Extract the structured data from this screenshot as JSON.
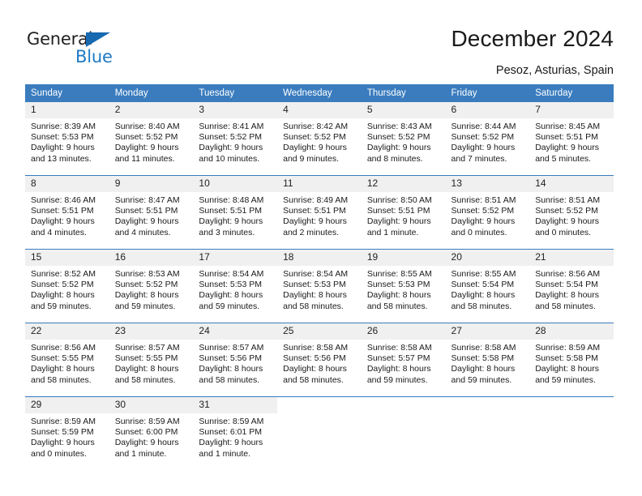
{
  "brand": {
    "name_part1": "General",
    "name_part2": "Blue",
    "accent_color": "#1f7ac4",
    "triangle_color": "#1769b0"
  },
  "header": {
    "title": "December 2024",
    "location": "Pesoz, Asturias, Spain"
  },
  "calendar": {
    "header_bg": "#3a7cbe",
    "daynum_bg": "#f0f0f0",
    "weekdays": [
      "Sunday",
      "Monday",
      "Tuesday",
      "Wednesday",
      "Thursday",
      "Friday",
      "Saturday"
    ],
    "weeks": [
      [
        {
          "day": "1",
          "sunrise": "Sunrise: 8:39 AM",
          "sunset": "Sunset: 5:53 PM",
          "daylight": "Daylight: 9 hours and 13 minutes."
        },
        {
          "day": "2",
          "sunrise": "Sunrise: 8:40 AM",
          "sunset": "Sunset: 5:52 PM",
          "daylight": "Daylight: 9 hours and 11 minutes."
        },
        {
          "day": "3",
          "sunrise": "Sunrise: 8:41 AM",
          "sunset": "Sunset: 5:52 PM",
          "daylight": "Daylight: 9 hours and 10 minutes."
        },
        {
          "day": "4",
          "sunrise": "Sunrise: 8:42 AM",
          "sunset": "Sunset: 5:52 PM",
          "daylight": "Daylight: 9 hours and 9 minutes."
        },
        {
          "day": "5",
          "sunrise": "Sunrise: 8:43 AM",
          "sunset": "Sunset: 5:52 PM",
          "daylight": "Daylight: 9 hours and 8 minutes."
        },
        {
          "day": "6",
          "sunrise": "Sunrise: 8:44 AM",
          "sunset": "Sunset: 5:52 PM",
          "daylight": "Daylight: 9 hours and 7 minutes."
        },
        {
          "day": "7",
          "sunrise": "Sunrise: 8:45 AM",
          "sunset": "Sunset: 5:51 PM",
          "daylight": "Daylight: 9 hours and 5 minutes."
        }
      ],
      [
        {
          "day": "8",
          "sunrise": "Sunrise: 8:46 AM",
          "sunset": "Sunset: 5:51 PM",
          "daylight": "Daylight: 9 hours and 4 minutes."
        },
        {
          "day": "9",
          "sunrise": "Sunrise: 8:47 AM",
          "sunset": "Sunset: 5:51 PM",
          "daylight": "Daylight: 9 hours and 4 minutes."
        },
        {
          "day": "10",
          "sunrise": "Sunrise: 8:48 AM",
          "sunset": "Sunset: 5:51 PM",
          "daylight": "Daylight: 9 hours and 3 minutes."
        },
        {
          "day": "11",
          "sunrise": "Sunrise: 8:49 AM",
          "sunset": "Sunset: 5:51 PM",
          "daylight": "Daylight: 9 hours and 2 minutes."
        },
        {
          "day": "12",
          "sunrise": "Sunrise: 8:50 AM",
          "sunset": "Sunset: 5:51 PM",
          "daylight": "Daylight: 9 hours and 1 minute."
        },
        {
          "day": "13",
          "sunrise": "Sunrise: 8:51 AM",
          "sunset": "Sunset: 5:52 PM",
          "daylight": "Daylight: 9 hours and 0 minutes."
        },
        {
          "day": "14",
          "sunrise": "Sunrise: 8:51 AM",
          "sunset": "Sunset: 5:52 PM",
          "daylight": "Daylight: 9 hours and 0 minutes."
        }
      ],
      [
        {
          "day": "15",
          "sunrise": "Sunrise: 8:52 AM",
          "sunset": "Sunset: 5:52 PM",
          "daylight": "Daylight: 8 hours and 59 minutes."
        },
        {
          "day": "16",
          "sunrise": "Sunrise: 8:53 AM",
          "sunset": "Sunset: 5:52 PM",
          "daylight": "Daylight: 8 hours and 59 minutes."
        },
        {
          "day": "17",
          "sunrise": "Sunrise: 8:54 AM",
          "sunset": "Sunset: 5:53 PM",
          "daylight": "Daylight: 8 hours and 59 minutes."
        },
        {
          "day": "18",
          "sunrise": "Sunrise: 8:54 AM",
          "sunset": "Sunset: 5:53 PM",
          "daylight": "Daylight: 8 hours and 58 minutes."
        },
        {
          "day": "19",
          "sunrise": "Sunrise: 8:55 AM",
          "sunset": "Sunset: 5:53 PM",
          "daylight": "Daylight: 8 hours and 58 minutes."
        },
        {
          "day": "20",
          "sunrise": "Sunrise: 8:55 AM",
          "sunset": "Sunset: 5:54 PM",
          "daylight": "Daylight: 8 hours and 58 minutes."
        },
        {
          "day": "21",
          "sunrise": "Sunrise: 8:56 AM",
          "sunset": "Sunset: 5:54 PM",
          "daylight": "Daylight: 8 hours and 58 minutes."
        }
      ],
      [
        {
          "day": "22",
          "sunrise": "Sunrise: 8:56 AM",
          "sunset": "Sunset: 5:55 PM",
          "daylight": "Daylight: 8 hours and 58 minutes."
        },
        {
          "day": "23",
          "sunrise": "Sunrise: 8:57 AM",
          "sunset": "Sunset: 5:55 PM",
          "daylight": "Daylight: 8 hours and 58 minutes."
        },
        {
          "day": "24",
          "sunrise": "Sunrise: 8:57 AM",
          "sunset": "Sunset: 5:56 PM",
          "daylight": "Daylight: 8 hours and 58 minutes."
        },
        {
          "day": "25",
          "sunrise": "Sunrise: 8:58 AM",
          "sunset": "Sunset: 5:56 PM",
          "daylight": "Daylight: 8 hours and 58 minutes."
        },
        {
          "day": "26",
          "sunrise": "Sunrise: 8:58 AM",
          "sunset": "Sunset: 5:57 PM",
          "daylight": "Daylight: 8 hours and 59 minutes."
        },
        {
          "day": "27",
          "sunrise": "Sunrise: 8:58 AM",
          "sunset": "Sunset: 5:58 PM",
          "daylight": "Daylight: 8 hours and 59 minutes."
        },
        {
          "day": "28",
          "sunrise": "Sunrise: 8:59 AM",
          "sunset": "Sunset: 5:58 PM",
          "daylight": "Daylight: 8 hours and 59 minutes."
        }
      ],
      [
        {
          "day": "29",
          "sunrise": "Sunrise: 8:59 AM",
          "sunset": "Sunset: 5:59 PM",
          "daylight": "Daylight: 9 hours and 0 minutes."
        },
        {
          "day": "30",
          "sunrise": "Sunrise: 8:59 AM",
          "sunset": "Sunset: 6:00 PM",
          "daylight": "Daylight: 9 hours and 1 minute."
        },
        {
          "day": "31",
          "sunrise": "Sunrise: 8:59 AM",
          "sunset": "Sunset: 6:01 PM",
          "daylight": "Daylight: 9 hours and 1 minute."
        },
        {
          "day": "",
          "sunrise": "",
          "sunset": "",
          "daylight": ""
        },
        {
          "day": "",
          "sunrise": "",
          "sunset": "",
          "daylight": ""
        },
        {
          "day": "",
          "sunrise": "",
          "sunset": "",
          "daylight": ""
        },
        {
          "day": "",
          "sunrise": "",
          "sunset": "",
          "daylight": ""
        }
      ]
    ]
  }
}
